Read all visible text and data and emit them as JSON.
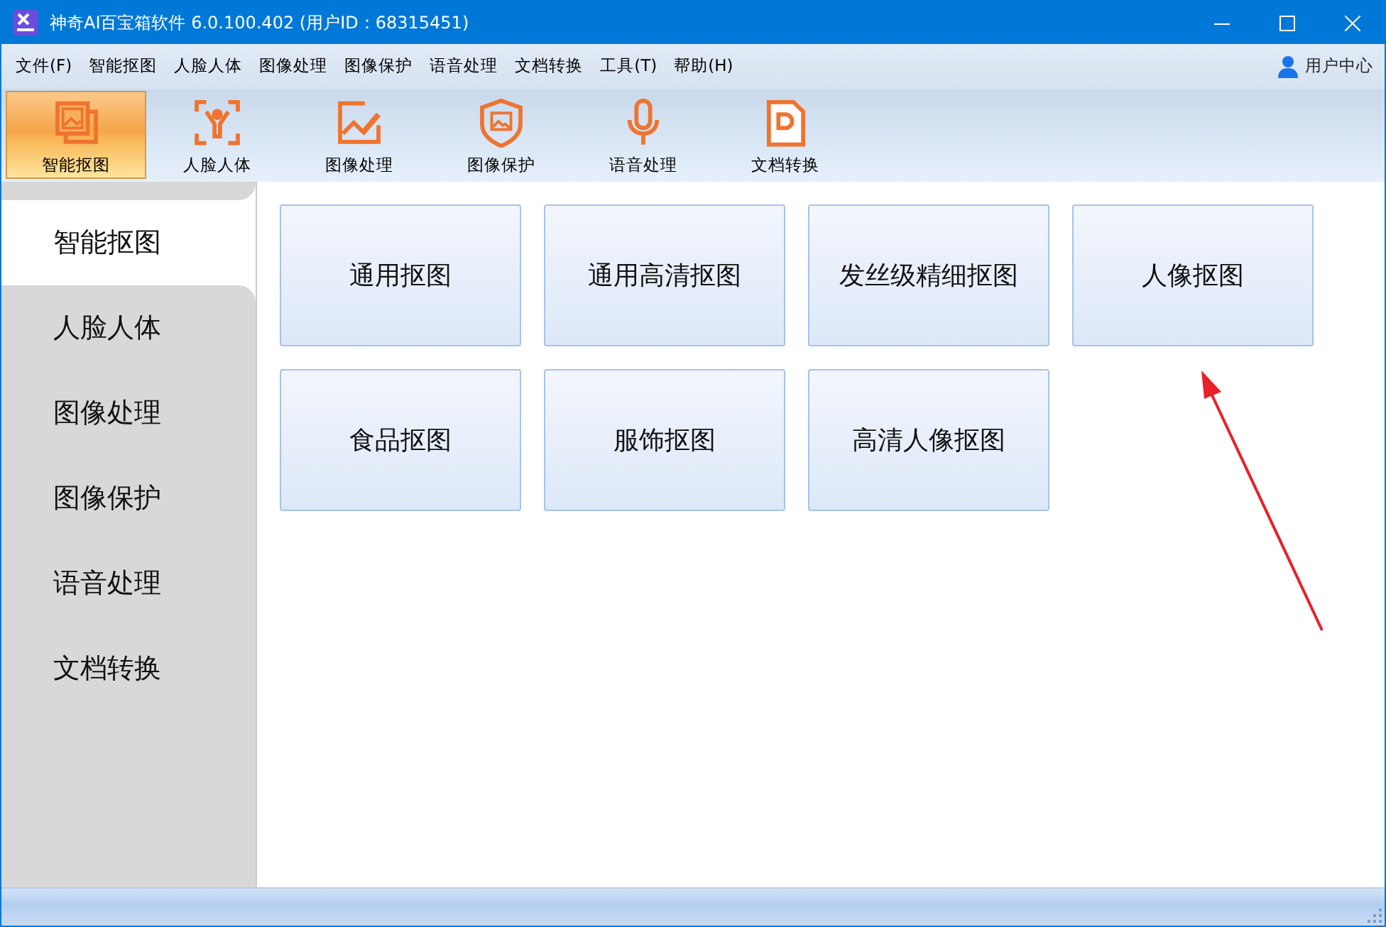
{
  "window": {
    "title": "神奇AI百宝箱软件 6.0.100.402 (用户ID：68315451)"
  },
  "menu": [
    "文件(F)",
    "智能抠图",
    "人脸人体",
    "图像处理",
    "图像保护",
    "语音处理",
    "文档转换",
    "工具(T)",
    "帮助(H)"
  ],
  "user_center": "用户中心",
  "toolbar": [
    {
      "label": "智能抠图",
      "selected": true
    },
    {
      "label": "人脸人体",
      "selected": false
    },
    {
      "label": "图像处理",
      "selected": false
    },
    {
      "label": "图像保护",
      "selected": false
    },
    {
      "label": "语音处理",
      "selected": false
    },
    {
      "label": "文档转换",
      "selected": false
    }
  ],
  "sidebar": {
    "items": [
      {
        "label": "智能抠图",
        "selected": true
      },
      {
        "label": "人脸人体",
        "selected": false
      },
      {
        "label": "图像处理",
        "selected": false
      },
      {
        "label": "图像保护",
        "selected": false
      },
      {
        "label": "语音处理",
        "selected": false
      },
      {
        "label": "文档转换",
        "selected": false
      }
    ]
  },
  "functions": [
    "通用抠图",
    "通用高清抠图",
    "发丝级精细抠图",
    "人像抠图",
    "食品抠图",
    "服饰抠图",
    "高清人像抠图"
  ]
}
